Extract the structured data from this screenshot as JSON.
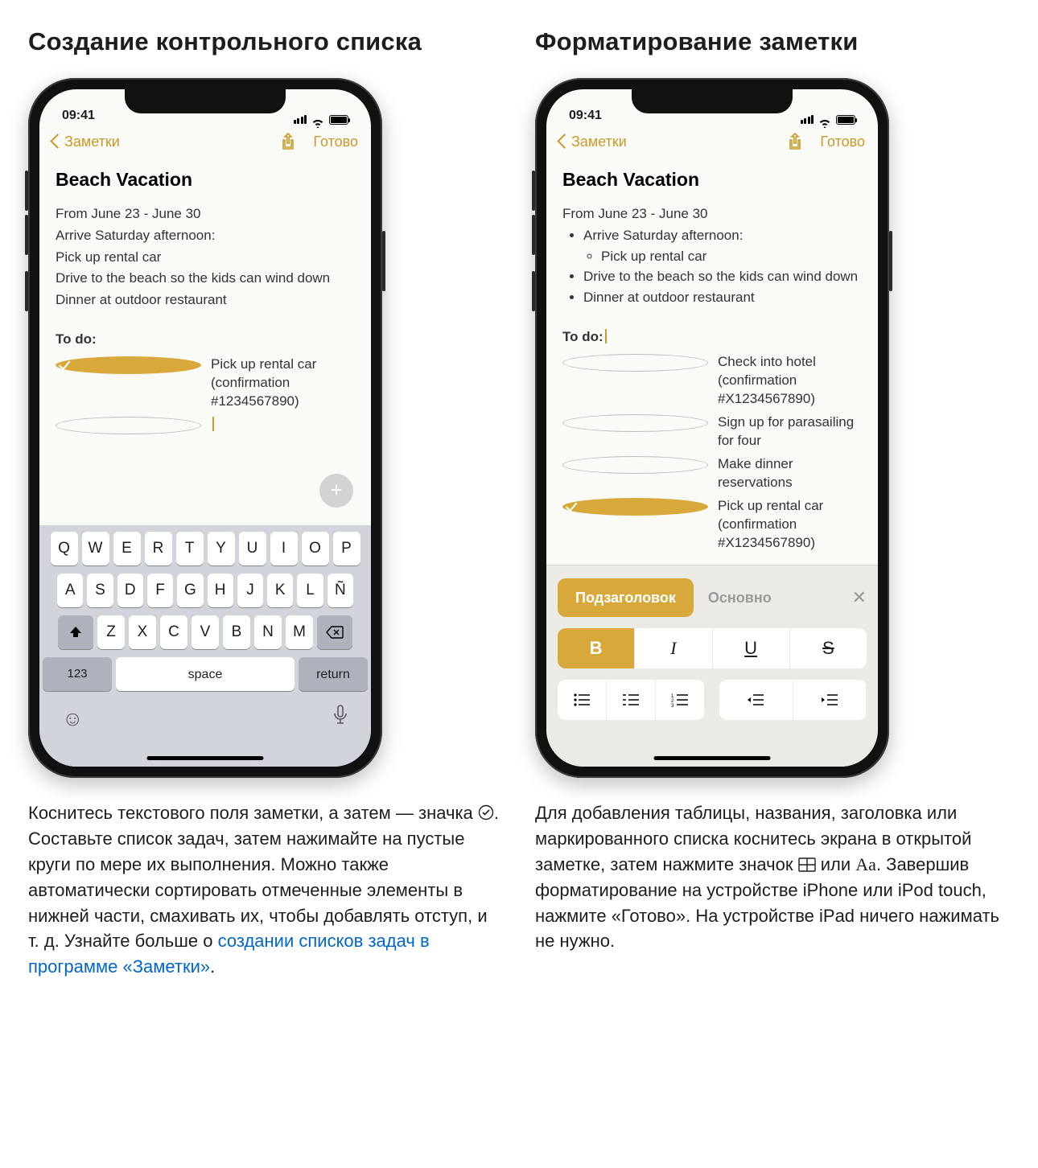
{
  "left": {
    "heading": "Создание контрольного списка",
    "status_time": "09:41",
    "nav_back": "Заметки",
    "nav_done": "Готово",
    "note_title": "Beach Vacation",
    "body": [
      "From June 23 - June 30",
      "Arrive Saturday afternoon:",
      "Pick up rental car",
      "Drive to the beach so the kids can wind down",
      "Dinner at outdoor restaurant"
    ],
    "todo_heading": "To do:",
    "todo_item": "Pick up rental car (confirmation #1234567890)",
    "kbd": {
      "r1": [
        "Q",
        "W",
        "E",
        "R",
        "T",
        "Y",
        "U",
        "I",
        "O",
        "P"
      ],
      "r2": [
        "A",
        "S",
        "D",
        "F",
        "G",
        "H",
        "J",
        "K",
        "L",
        "Ñ"
      ],
      "r3": [
        "Z",
        "X",
        "C",
        "V",
        "B",
        "N",
        "M"
      ],
      "num": "123",
      "space": "space",
      "return": "return"
    },
    "caption_pre": "Коснитесь текстового поля заметки, а затем — значка ",
    "caption_mid": ". Составьте список задач, затем нажимайте на пустые круги по мере их выполнения. Можно также автоматически сортировать отмеченные элементы в нижней части, смахивать их, чтобы добавлять отступ, и т. д. Узнайте больше о ",
    "caption_link": "создании списков задач в программе «Заметки»",
    "caption_post": "."
  },
  "right": {
    "heading": "Форматирование заметки",
    "status_time": "09:41",
    "nav_back": "Заметки",
    "nav_done": "Готово",
    "note_title": "Beach Vacation",
    "line1": "From June 23 - June 30",
    "bul1": "Arrive Saturday afternoon:",
    "bul1a": "Pick up rental car",
    "bul2": "Drive to the beach so the kids can wind down",
    "bul3": "Dinner at outdoor restaurant",
    "todo_heading": "To do:",
    "todos": [
      {
        "done": false,
        "text": "Check into hotel (confirmation #X1234567890)"
      },
      {
        "done": false,
        "text": "Sign up for parasailing for four"
      },
      {
        "done": false,
        "text": "Make dinner reservations"
      },
      {
        "done": true,
        "text": "Pick up rental car (confirmation #X1234567890)"
      }
    ],
    "fmt_chip1": "Подзаголовок",
    "fmt_chip2": "Основно",
    "B": "B",
    "I": "I",
    "U": "U",
    "S": "S",
    "caption_a": "Для добавления таблицы, названия, заголовка или маркированного списка коснитесь экрана в открытой заметке, затем нажмите значок ",
    "caption_b": " или ",
    "caption_c": ". Завершив форматирование на устройстве iPhone или iPod touch, нажмите «Готово». На устройстве iPad ничего нажимать не нужно.",
    "aa": "Aa"
  }
}
